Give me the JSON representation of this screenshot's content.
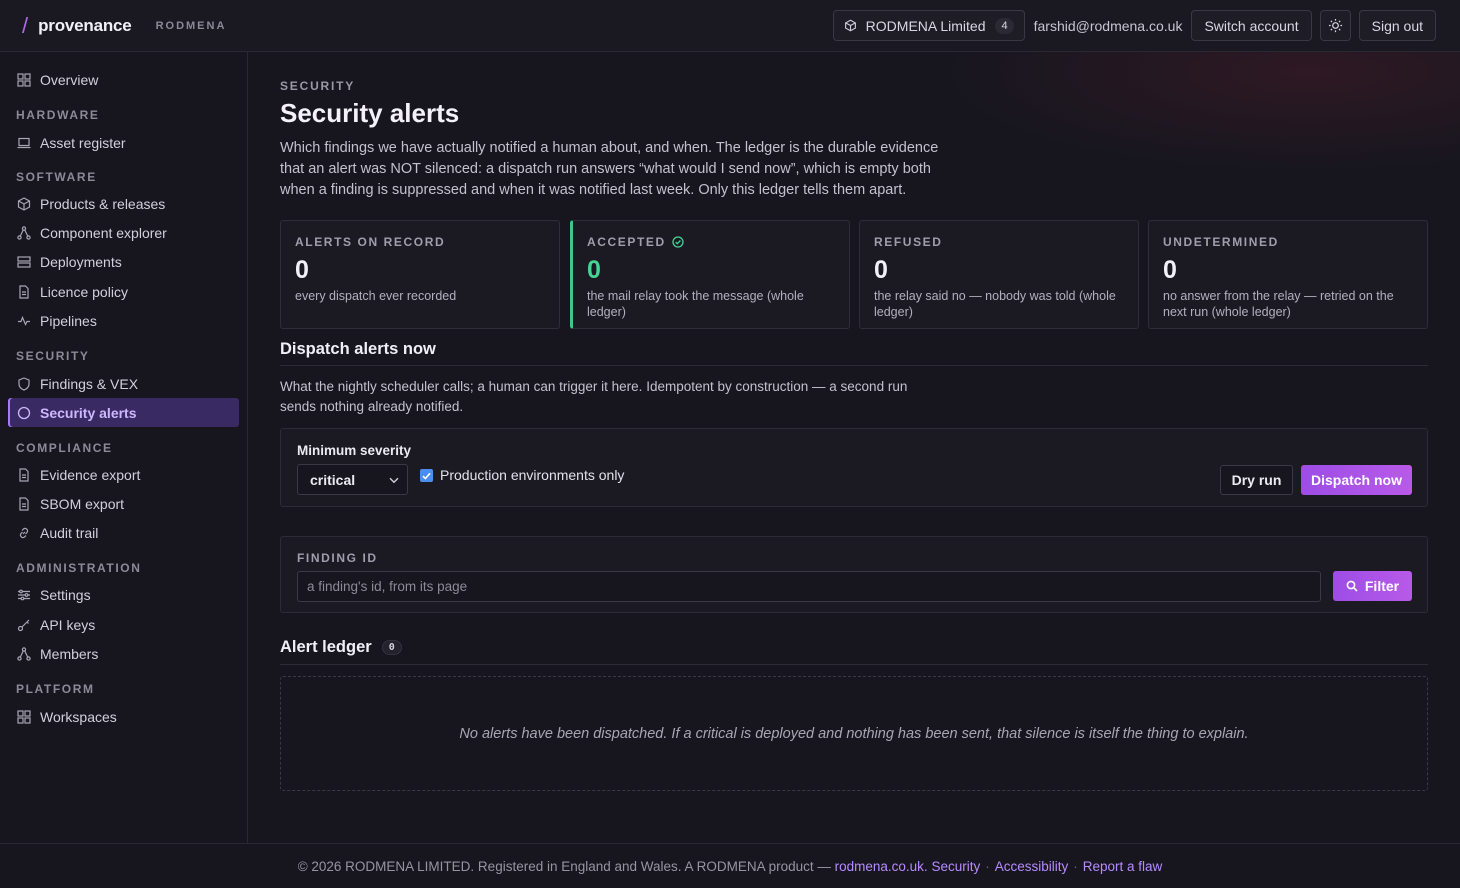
{
  "brand": {
    "name": "provenance",
    "org": "RODMENA"
  },
  "topbar": {
    "org_name": "RODMENA Limited",
    "org_count": "4",
    "email": "farshid@rodmena.co.uk",
    "switch_label": "Switch account",
    "signout_label": "Sign out"
  },
  "sidebar": {
    "overview": "Overview",
    "sections": {
      "hardware": "HARDWARE",
      "software": "SOFTWARE",
      "security": "SECURITY",
      "compliance": "COMPLIANCE",
      "administration": "ADMINISTRATION",
      "platform": "PLATFORM"
    },
    "items": {
      "asset_register": "Asset register",
      "products": "Products & releases",
      "component_explorer": "Component explorer",
      "deployments": "Deployments",
      "licence_policy": "Licence policy",
      "pipelines": "Pipelines",
      "findings": "Findings & VEX",
      "security_alerts": "Security alerts",
      "evidence_export": "Evidence export",
      "sbom_export": "SBOM export",
      "audit_trail": "Audit trail",
      "settings": "Settings",
      "api_keys": "API keys",
      "members": "Members",
      "workspaces": "Workspaces"
    }
  },
  "page": {
    "eyebrow": "SECURITY",
    "title": "Security alerts",
    "intro": "Which findings we have actually notified a human about, and when. The ledger is the durable evidence that an alert was NOT silenced: a dispatch run answers “what would I send now”, which is empty both when a finding is suppressed and when it was notified last week. Only this ledger tells them apart."
  },
  "stats": [
    {
      "label": "ALERTS ON RECORD",
      "value": "0",
      "desc": "every dispatch ever recorded"
    },
    {
      "label": "ACCEPTED",
      "value": "0",
      "desc": "the mail relay took the message (whole ledger)"
    },
    {
      "label": "REFUSED",
      "value": "0",
      "desc": "the relay said no — nobody was told (whole ledger)"
    },
    {
      "label": "UNDETERMINED",
      "value": "0",
      "desc": "no answer from the relay — retried on the next run (whole ledger)"
    }
  ],
  "dispatch": {
    "heading": "Dispatch alerts now",
    "description": "What the nightly scheduler calls; a human can trigger it here. Idempotent by construction — a second run sends nothing already notified.",
    "severity_label": "Minimum severity",
    "severity_value": "critical",
    "prod_only_label": "Production environments only",
    "prod_only_checked": true,
    "dry_run_label": "Dry run",
    "dispatch_label": "Dispatch now"
  },
  "filter": {
    "label": "FINDING ID",
    "placeholder": "a finding's id, from its page",
    "button_label": "Filter"
  },
  "ledger": {
    "heading": "Alert ledger",
    "count": "0",
    "empty_message": "No alerts have been dispatched. If a critical is deployed and nothing has been sent, that silence is itself the thing to explain."
  },
  "footer": {
    "text": "© 2026 RODMENA LIMITED. Registered in England and Wales. A RODMENA product —",
    "site_link": "rodmena.co.uk.",
    "security_link": "Security",
    "accessibility_link": "Accessibility",
    "flaw_link": "Report a flaw",
    "separator": "·"
  },
  "colors": {
    "accent": "#b85ae8",
    "active_nav": "#3a2a63",
    "accepted_green": "#46d494",
    "background": "#17161f"
  }
}
